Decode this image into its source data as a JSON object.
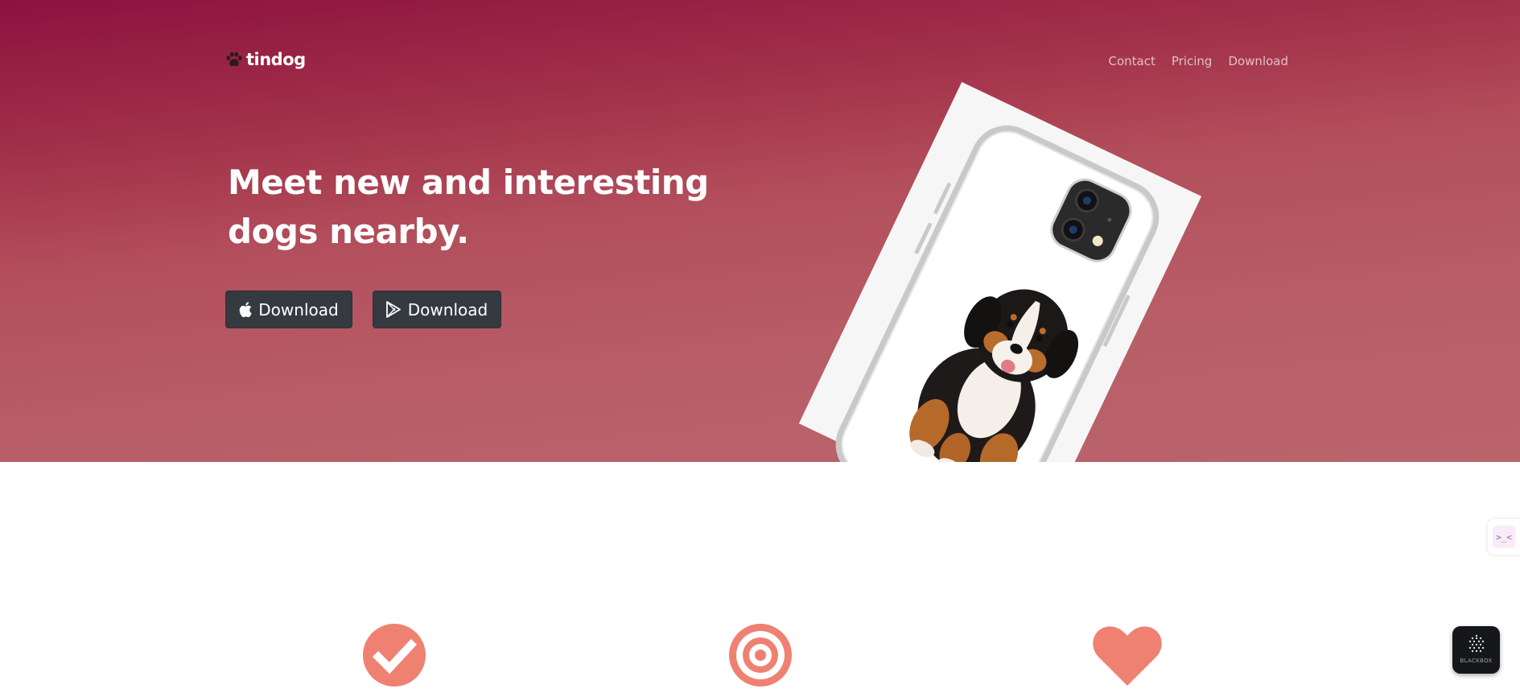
{
  "brand": {
    "name": "tindog",
    "icon": "paw-icon"
  },
  "nav": {
    "items": [
      "Contact",
      "Pricing",
      "Download"
    ]
  },
  "hero": {
    "headline_line1": "Meet new and interesting",
    "headline_line2": "dogs nearby.",
    "button_ios": "Download",
    "button_android": "Download",
    "button_ios_icon": "apple-icon",
    "button_android_icon": "google-play-icon"
  },
  "features": {
    "icons": [
      "check-circle-icon",
      "bullseye-icon",
      "heart-icon"
    ]
  },
  "widgets": {
    "blackbox_label": "BLACKBOX",
    "side_widget_text": ">_<"
  },
  "colors": {
    "hero_top": "#8c1240",
    "hero_bottom": "#ba646c",
    "button_dark": "#343a40",
    "feature_icon": "#ef8172"
  }
}
